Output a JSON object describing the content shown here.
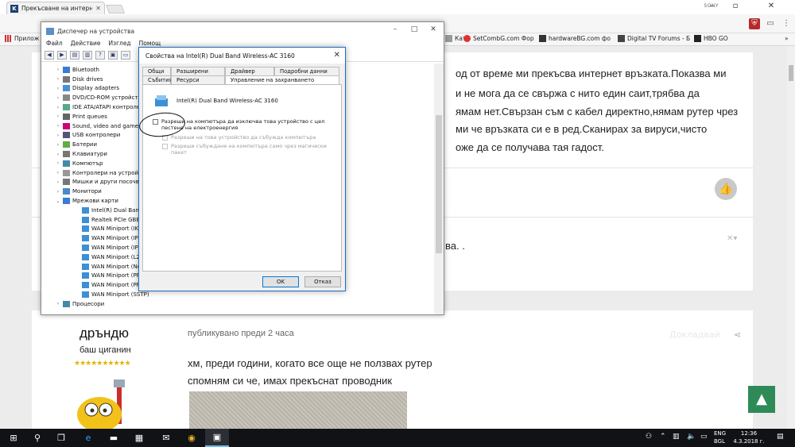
{
  "browser": {
    "tab_title": "Прекъсване на интерне",
    "tab_favicon_letter": "K",
    "profile_label": "SONY",
    "apps_label": "Прилож",
    "bookmarks": [
      {
        "label": "Ката",
        "icon": "bookmark-icon"
      },
      {
        "label": "SetCombG.com Фор",
        "icon": "setcombg-icon"
      },
      {
        "label": "hardwareBG.com фо",
        "icon": "hardwarebg-icon"
      },
      {
        "label": "Digital TV Forums - Б",
        "icon": "digitaltv-icon"
      },
      {
        "label": "HBO GO",
        "icon": "hbo-icon"
      }
    ]
  },
  "post": {
    "lines": [
      "од от време ми прекъсва интернет връзката.Показва ми",
      "и не мога да се свържа с нито един саит,трябва да",
      "ямам нет.Свързан съм с кабел директно,нямам рутер чрез",
      "ми че връзката си е в ред.Сканирах за вируси,чисто",
      "оже да се получава тая гадост."
    ],
    "quote_fragment": "ва. ."
  },
  "reply": {
    "username": "дръндю",
    "user_title": "баш циганин",
    "stars": "★★★★★★★★★★",
    "posted": "публикувано преди 2 часа",
    "faded_label": "Докладвай",
    "lines": [
      "хм, преди години, когато все още не ползвах рутер",
      "спомням си че, имах прекъснат проводник"
    ]
  },
  "device_manager": {
    "title": "Диспечер на устройства",
    "menu": [
      "Файл",
      "Действие",
      "Изглед",
      "Помощ"
    ],
    "tree": [
      {
        "label": "Bluetooth",
        "level": 1,
        "expanded": false
      },
      {
        "label": "Disk drives",
        "level": 1,
        "expanded": false
      },
      {
        "label": "Display adapters",
        "level": 1,
        "expanded": false
      },
      {
        "label": "DVD/CD-ROM устройст",
        "level": 1,
        "expanded": false
      },
      {
        "label": "IDE ATA/ATAPI контроле",
        "level": 1,
        "expanded": false
      },
      {
        "label": "Print queues",
        "level": 1,
        "expanded": false
      },
      {
        "label": "Sound, video and game",
        "level": 1,
        "expanded": false
      },
      {
        "label": "USB контролери",
        "level": 1,
        "expanded": false
      },
      {
        "label": "Батерии",
        "level": 1,
        "expanded": false
      },
      {
        "label": "Клавиатури",
        "level": 1,
        "expanded": false
      },
      {
        "label": "Компютър",
        "level": 1,
        "expanded": false
      },
      {
        "label": "Контролери на устрой",
        "level": 1,
        "expanded": false
      },
      {
        "label": "Мишки и други посочв",
        "level": 1,
        "expanded": false
      },
      {
        "label": "Монитори",
        "level": 1,
        "expanded": false
      },
      {
        "label": "Мрежови карти",
        "level": 1,
        "expanded": true
      },
      {
        "label": "Intel(R) Dual Band W",
        "level": 2
      },
      {
        "label": "Realtek PCIe GBE Far",
        "level": 2
      },
      {
        "label": "WAN Miniport (IKEv",
        "level": 2
      },
      {
        "label": "WAN Miniport (IP)",
        "level": 2
      },
      {
        "label": "WAN Miniport (IPv6)",
        "level": 2
      },
      {
        "label": "WAN Miniport (L2TP",
        "level": 2
      },
      {
        "label": "WAN Miniport (Netw",
        "level": 2
      },
      {
        "label": "WAN Miniport (PPPO",
        "level": 2
      },
      {
        "label": "WAN Miniport (PPTP",
        "level": 2
      },
      {
        "label": "WAN Miniport (SSTP)",
        "level": 2
      },
      {
        "label": "Процесори",
        "level": 1,
        "expanded": false
      }
    ]
  },
  "properties": {
    "title": "Свойства на Intel(R) Dual Band Wireless-AC 3160",
    "tabs_row1": [
      "Общи",
      "Разширени",
      "Драйвер",
      "Подробни данни"
    ],
    "tabs_row2": [
      "Събития",
      "Ресурси",
      "Управление на захранването"
    ],
    "device_name": "Intel(R) Dual Band Wireless-AC 3160",
    "options": [
      {
        "label": "Разреши на компютъра да изключва това устройство с цел пестене на електроенергия",
        "checked": false,
        "disabled": false
      },
      {
        "label": "Разреши на това устройство да събужда компютъра",
        "checked": false,
        "disabled": true
      },
      {
        "label": "Разреши събуждане на компютъра само чрез магически пакет",
        "checked": false,
        "disabled": true
      }
    ],
    "ok_label": "OK",
    "cancel_label": "Отказ"
  },
  "taskbar": {
    "lang_line1": "ENG",
    "lang_line2": "BGL",
    "time": "12:36",
    "date": "4.3.2018 г."
  }
}
